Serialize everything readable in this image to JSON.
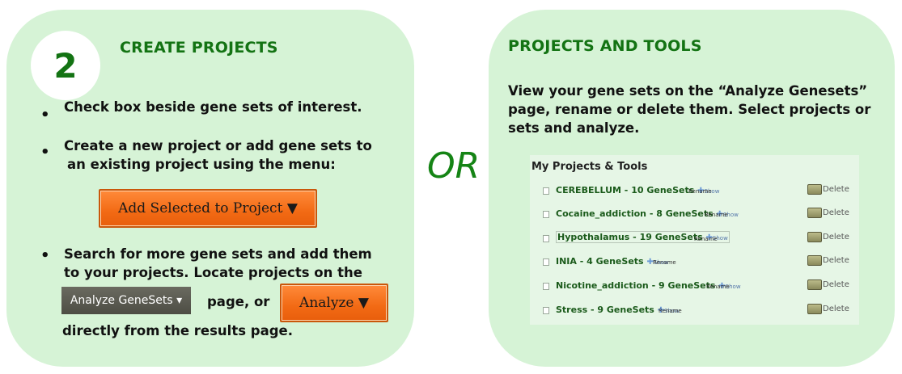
{
  "left": {
    "step": "2",
    "title": "CREATE PROJECTS",
    "bullet_char": "•",
    "b1": "Check box beside gene sets of interest.",
    "b2_line1": "Create a new project or add gene sets to",
    "b2_line2": "an existing project using the menu:",
    "add_btn": "Add Selected to Project ▼",
    "b3_line1": "Search for more gene sets and add them",
    "b3_line2": "to your projects.  Locate projects on the",
    "analyze_genesets_btn": "Analyze GeneSets ▾",
    "page_or": "page, or",
    "analyze_btn": "Analyze ▼",
    "b3_line4": "directly from the results page."
  },
  "or_label": "OR",
  "right": {
    "title": "PROJECTS AND TOOLS",
    "desc_line1": "View your gene sets on the “Analyze Genesets”",
    "desc_line2": "page, rename or delete them. Select projects or",
    "desc_line3": "sets and analyze.",
    "box_heading": "My Projects & Tools",
    "projects": [
      {
        "name": "CEREBELLUM - 10 GeneSets",
        "show": "Show",
        "rename": "Rename",
        "delete": "Delete"
      },
      {
        "name": "Cocaine_addiction - 8 GeneSets",
        "show": "Show",
        "rename": "Rename",
        "delete": "Delete"
      },
      {
        "name": "Hypothalamus - 19 GeneSets",
        "show": "Show",
        "rename": "Rename",
        "delete": "Delete"
      },
      {
        "name": "INIA - 4 GeneSets",
        "show": "Show",
        "rename": "Rename",
        "delete": "Delete"
      },
      {
        "name": "Nicotine_addiction - 9 GeneSets",
        "show": "Show",
        "rename": "Rename",
        "delete": "Delete"
      },
      {
        "name": "Stress - 9 GeneSets",
        "show": "Show",
        "rename": "Rename",
        "delete": "Delete"
      }
    ]
  },
  "icons": {
    "plus": "plus-icon",
    "trash": "trash-icon",
    "checkbox": "checkbox"
  },
  "colors": {
    "panel_bg": "#d6f3d6",
    "title_green": "#137313",
    "or_green": "#158415",
    "button_orange": "#f26a14"
  }
}
